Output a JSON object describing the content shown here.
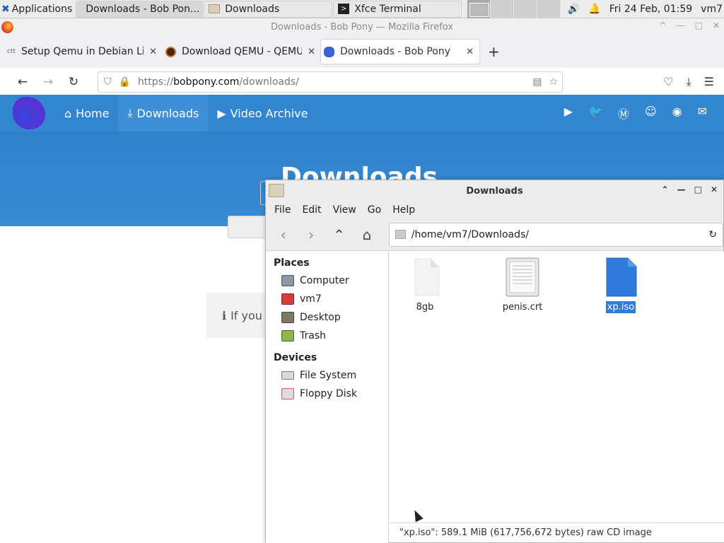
{
  "taskbar": {
    "applications_label": "Applications",
    "tasks": [
      {
        "label": "Downloads - Bob Pon...",
        "icon": "firefox-icon"
      },
      {
        "label": "Downloads",
        "icon": "folder-icon"
      },
      {
        "label": "Xfce Terminal",
        "icon": "terminal-icon"
      }
    ],
    "clock": "Fri 24 Feb, 01:59",
    "user": "vm7"
  },
  "firefox": {
    "window_title": "Downloads - Bob Pony — Mozilla Firefox",
    "tabs": [
      {
        "label": "Setup Qemu in Debian Li",
        "icon": "ctt-icon"
      },
      {
        "label": "Download QEMU - QEMU",
        "icon": "qemu-icon"
      },
      {
        "label": "Downloads - Bob Pony",
        "icon": "bobpony-icon"
      }
    ],
    "url_prefix": "https://",
    "url_host": "bobpony.com",
    "url_path": "/downloads/"
  },
  "site": {
    "nav": [
      "Home",
      "Downloads",
      "Video Archive"
    ],
    "hero_title": "Downloads",
    "info_text": "If you",
    "social_icons": [
      "youtube-icon",
      "twitter-icon",
      "mastodon-icon",
      "discord-icon",
      "github-icon",
      "mail-icon"
    ]
  },
  "filemanager": {
    "title": "Downloads",
    "menu": [
      "File",
      "Edit",
      "View",
      "Go",
      "Help"
    ],
    "path": "/home/vm7/Downloads/",
    "places_heading": "Places",
    "places": [
      "Computer",
      "vm7",
      "Desktop",
      "Trash"
    ],
    "devices_heading": "Devices",
    "devices": [
      "File System",
      "Floppy Disk"
    ],
    "files": [
      {
        "name": "8gb",
        "type": "blank"
      },
      {
        "name": "penis.crt",
        "type": "certificate"
      },
      {
        "name": "xp.iso",
        "type": "disc-image",
        "selected": true
      }
    ],
    "status": "\"xp.iso\": 589.1 MiB (617,756,672 bytes) raw CD image"
  },
  "colors": {
    "site_blue": "#3286d0",
    "selection": "#2f7adb",
    "iso_blue": "#2f7adb"
  }
}
